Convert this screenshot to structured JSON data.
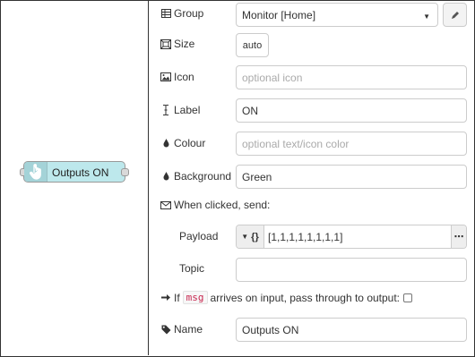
{
  "node": {
    "label": "Outputs ON",
    "color": "#bde8ec",
    "icon": "touch-hand-icon"
  },
  "form": {
    "group": {
      "label": "Group",
      "value": "Monitor [Home]",
      "icon": "table-icon"
    },
    "size": {
      "label": "Size",
      "value": "auto",
      "icon": "resize-icon"
    },
    "icon": {
      "label": "Icon",
      "placeholder": "optional icon",
      "value": "",
      "icon": "image-icon"
    },
    "label": {
      "label": "Label",
      "value": "ON",
      "icon": "text-cursor-icon"
    },
    "colour": {
      "label": "Colour",
      "placeholder": "optional text/icon color",
      "value": "",
      "icon": "drop-icon"
    },
    "background": {
      "label": "Background",
      "value": "Green",
      "icon": "drop-icon"
    },
    "when_clicked": {
      "label": "When clicked, send:",
      "icon": "envelope-icon"
    },
    "payload": {
      "label": "Payload",
      "type_label": "{}",
      "value": "[1,1,1,1,1,1,1,1]"
    },
    "topic": {
      "label": "Topic",
      "value": ""
    },
    "passthrough": {
      "prefix": "If",
      "code": "msg",
      "suffix": "arrives on input, pass through to output:",
      "checked": false
    },
    "name": {
      "label": "Name",
      "value": "Outputs ON",
      "icon": "tag-icon"
    }
  }
}
